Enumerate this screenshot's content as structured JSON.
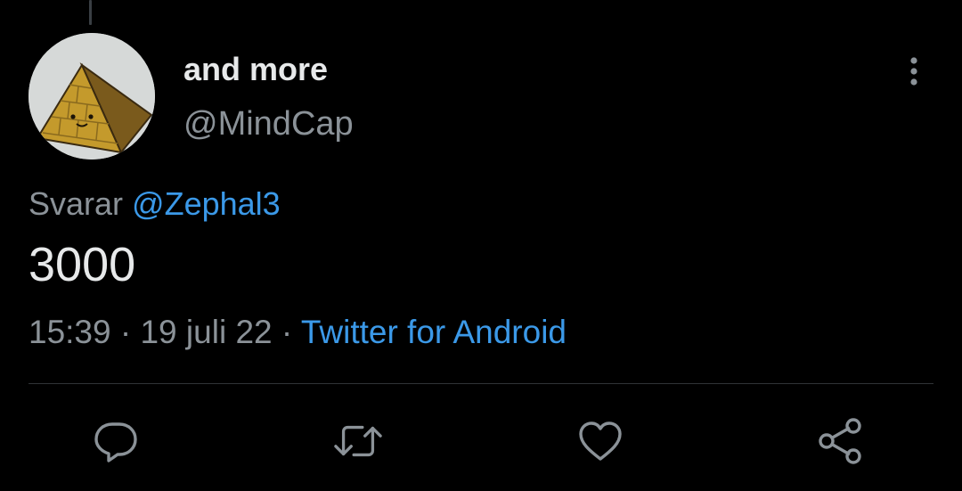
{
  "tweet": {
    "author": {
      "display_name": "and more",
      "handle": "@MindCap",
      "avatar_icon": "pyramid-avatar"
    },
    "reply_to": {
      "prefix": "Svarar",
      "mention": "@Zephal3"
    },
    "text": "3000",
    "meta": {
      "time": "15:39",
      "separator": " · ",
      "date": "19 juli 22",
      "source": "Twitter for Android"
    }
  },
  "actions": [
    {
      "name": "reply",
      "icon": "speech-bubble-icon"
    },
    {
      "name": "retweet",
      "icon": "retweet-arrows-icon"
    },
    {
      "name": "like",
      "icon": "heart-icon"
    },
    {
      "name": "share",
      "icon": "share-nodes-icon"
    }
  ],
  "more_menu_icon": "vertical-dots-icon",
  "colors": {
    "background": "#000000",
    "primary_text": "#e7e9ea",
    "secondary_text": "#8b9298",
    "link": "#3b99e8",
    "divider": "#2f3336",
    "icon": "#8b9298"
  }
}
